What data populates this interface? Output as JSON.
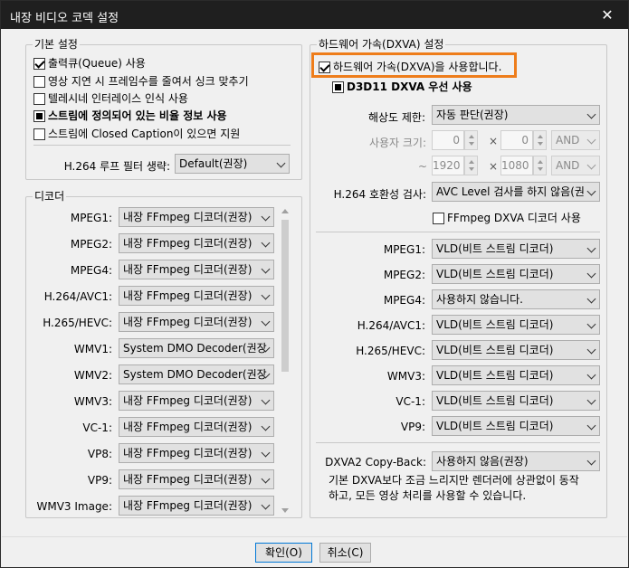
{
  "window": {
    "title": "내장 비디오 코덱 설정"
  },
  "basic": {
    "group_title": "기본 설정",
    "options": [
      {
        "label": "출력큐(Queue) 사용",
        "state": "checked"
      },
      {
        "label": "영상 지연 시 프레임수를 줄여서 싱크 맞추기",
        "state": "unchecked"
      },
      {
        "label": "텔레시네 인터레이스 인식 사용",
        "state": "unchecked"
      },
      {
        "label": "스트림에 정의되어 있는 비율 정보 사용",
        "state": "indeterminate"
      },
      {
        "label": "스트림에 Closed Caption이 있으면 지원",
        "state": "unchecked"
      }
    ],
    "h264_loop_label": "H.264 루프 필터 생략:",
    "h264_loop_value": "Default(권장)"
  },
  "decoder": {
    "group_title": "디코더",
    "rows": [
      {
        "label": "MPEG1:",
        "value": "내장 FFmpeg 디코더(권장)"
      },
      {
        "label": "MPEG2:",
        "value": "내장 FFmpeg 디코더(권장)"
      },
      {
        "label": "MPEG4:",
        "value": "내장 FFmpeg 디코더(권장)"
      },
      {
        "label": "H.264/AVC1:",
        "value": "내장 FFmpeg 디코더(권장)"
      },
      {
        "label": "H.265/HEVC:",
        "value": "내장 FFmpeg 디코더(권장)"
      },
      {
        "label": "WMV1:",
        "value": "System DMO Decoder(권장"
      },
      {
        "label": "WMV2:",
        "value": "System DMO Decoder(권장"
      },
      {
        "label": "WMV3:",
        "value": "내장 FFmpeg 디코더(권장)"
      },
      {
        "label": "VC-1:",
        "value": "내장 FFmpeg 디코더(권장)"
      },
      {
        "label": "VP8:",
        "value": "내장 FFmpeg 디코더(권장)"
      },
      {
        "label": "VP9:",
        "value": "내장 FFmpeg 디코더(권장)"
      },
      {
        "label": "WMV3 Image:",
        "value": "내장 FFmpeg 디코더(권장)"
      }
    ]
  },
  "hw": {
    "group_title": "하드웨어 가속(DXVA) 설정",
    "enable_label": "하드웨어 가속(DXVA)을 사용합니다.",
    "d3d11_label": "D3D11 DXVA 우선 사용",
    "resolution_label": "해상도 제한:",
    "resolution_value": "자동 판단(권장)",
    "user_size_label": "사용자 크기:",
    "min_w": "0",
    "min_h": "0",
    "times": "×",
    "and1": "AND",
    "tilde": "~",
    "max_w": "1920",
    "max_h": "1080",
    "and2": "AND",
    "h264_compat_label": "H.264 호환성 검사:",
    "h264_compat_value": "AVC Level 검사를 하지 않음(권",
    "ffmpeg_dxva_label": "FFmpeg DXVA 디코더 사용",
    "rows": [
      {
        "label": "MPEG1:",
        "value": "VLD(비트 스트림 디코더)"
      },
      {
        "label": "MPEG2:",
        "value": "VLD(비트 스트림 디코더)"
      },
      {
        "label": "MPEG4:",
        "value": "사용하지 않습니다."
      },
      {
        "label": "H.264/AVC1:",
        "value": "VLD(비트 스트림 디코더)"
      },
      {
        "label": "H.265/HEVC:",
        "value": "VLD(비트 스트림 디코더)"
      },
      {
        "label": "WMV3:",
        "value": "VLD(비트 스트림 디코더)"
      },
      {
        "label": "VC-1:",
        "value": "VLD(비트 스트림 디코더)"
      },
      {
        "label": "VP9:",
        "value": "VLD(비트 스트림 디코더)"
      }
    ],
    "copyback_label": "DXVA2 Copy-Back:",
    "copyback_value": "사용하지 않음(권장)",
    "copyback_desc_1": "기본 DXVA보다 조금 느리지만 렌더러에 상관없이 동작",
    "copyback_desc_2": "하고, 모든 영상 처리를 사용할 수 있습니다."
  },
  "footer": {
    "ok_label": "확인(O)",
    "cancel_label": "취소(C)"
  },
  "colors": {
    "highlight": "#ee7d1b",
    "titlebar": "#1f1f1f"
  }
}
